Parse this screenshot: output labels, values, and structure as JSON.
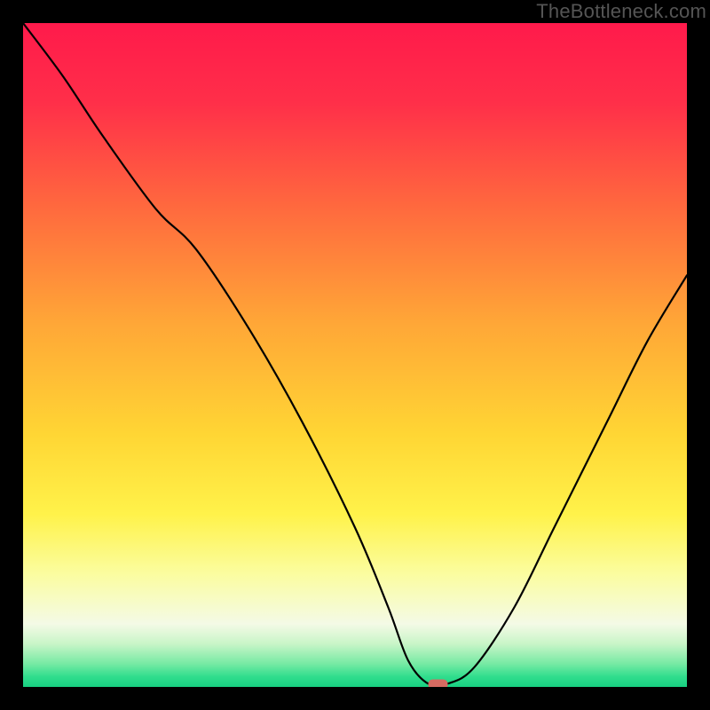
{
  "watermark": "TheBottleneck.com",
  "chart_data": {
    "type": "line",
    "title": "",
    "xlabel": "",
    "ylabel": "",
    "xlim": [
      0,
      100
    ],
    "ylim": [
      0,
      100
    ],
    "note": "No axes or tick labels are rendered. Curve shows bottleneck percentage (y) vs. some parameter (x); values are estimated from pixel positions, 0–100 scale.",
    "series": [
      {
        "name": "bottleneck-curve",
        "x": [
          0,
          6,
          12,
          20,
          26,
          34,
          42,
          50,
          55,
          58,
          61,
          64,
          68,
          74,
          80,
          88,
          94,
          100
        ],
        "y": [
          100,
          92,
          83,
          72,
          66,
          54,
          40,
          24,
          12,
          4,
          0.5,
          0.5,
          3,
          12,
          24,
          40,
          52,
          62
        ]
      }
    ],
    "marker": {
      "name": "optimal-point",
      "x": 62.5,
      "y": 0.4,
      "color": "#d66a61",
      "shape": "pill"
    },
    "background_gradient_stops": [
      {
        "offset": 0.0,
        "color": "#ff1a4b"
      },
      {
        "offset": 0.12,
        "color": "#ff2f49"
      },
      {
        "offset": 0.28,
        "color": "#ff6a3e"
      },
      {
        "offset": 0.45,
        "color": "#ffa637"
      },
      {
        "offset": 0.62,
        "color": "#ffd634"
      },
      {
        "offset": 0.74,
        "color": "#fff24a"
      },
      {
        "offset": 0.83,
        "color": "#fbfda0"
      },
      {
        "offset": 0.905,
        "color": "#f4fae6"
      },
      {
        "offset": 0.935,
        "color": "#c9f5c8"
      },
      {
        "offset": 0.965,
        "color": "#77eaa4"
      },
      {
        "offset": 0.985,
        "color": "#2fdd8d"
      },
      {
        "offset": 1.0,
        "color": "#18d081"
      }
    ]
  }
}
